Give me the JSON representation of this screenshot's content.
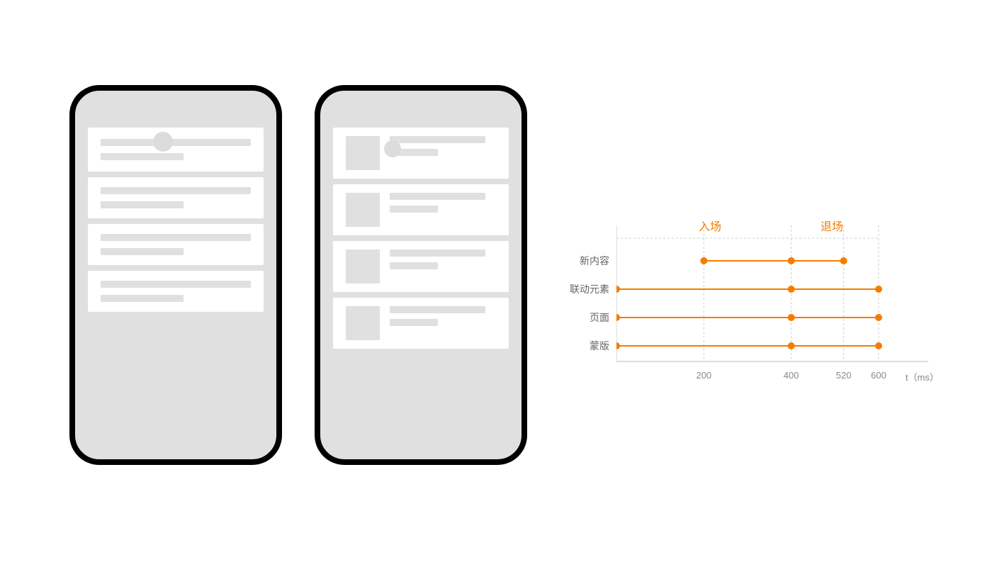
{
  "chart_data": {
    "type": "timeline",
    "title_enter": "入场",
    "title_exit": "退场",
    "x_axis_label": "t（ms）",
    "x_ticks": [
      200,
      400,
      520,
      600
    ],
    "x_range": [
      0,
      600
    ],
    "grid_verticals_ms": [
      0,
      200,
      400,
      520,
      600
    ],
    "rows": [
      {
        "label": "新内容",
        "enter": [
          200,
          400
        ],
        "exit": [
          400,
          520
        ]
      },
      {
        "label": "联动元素",
        "enter": [
          0,
          400
        ],
        "exit": [
          400,
          600
        ]
      },
      {
        "label": "页面",
        "enter": [
          0,
          400
        ],
        "exit": [
          400,
          600
        ]
      },
      {
        "label": "蒙版",
        "enter": [
          0,
          400
        ],
        "exit": [
          400,
          600
        ]
      }
    ],
    "accent_color": "#f57c00"
  },
  "layout": {
    "phone_left_items": 4,
    "phone_right_items": 4
  }
}
